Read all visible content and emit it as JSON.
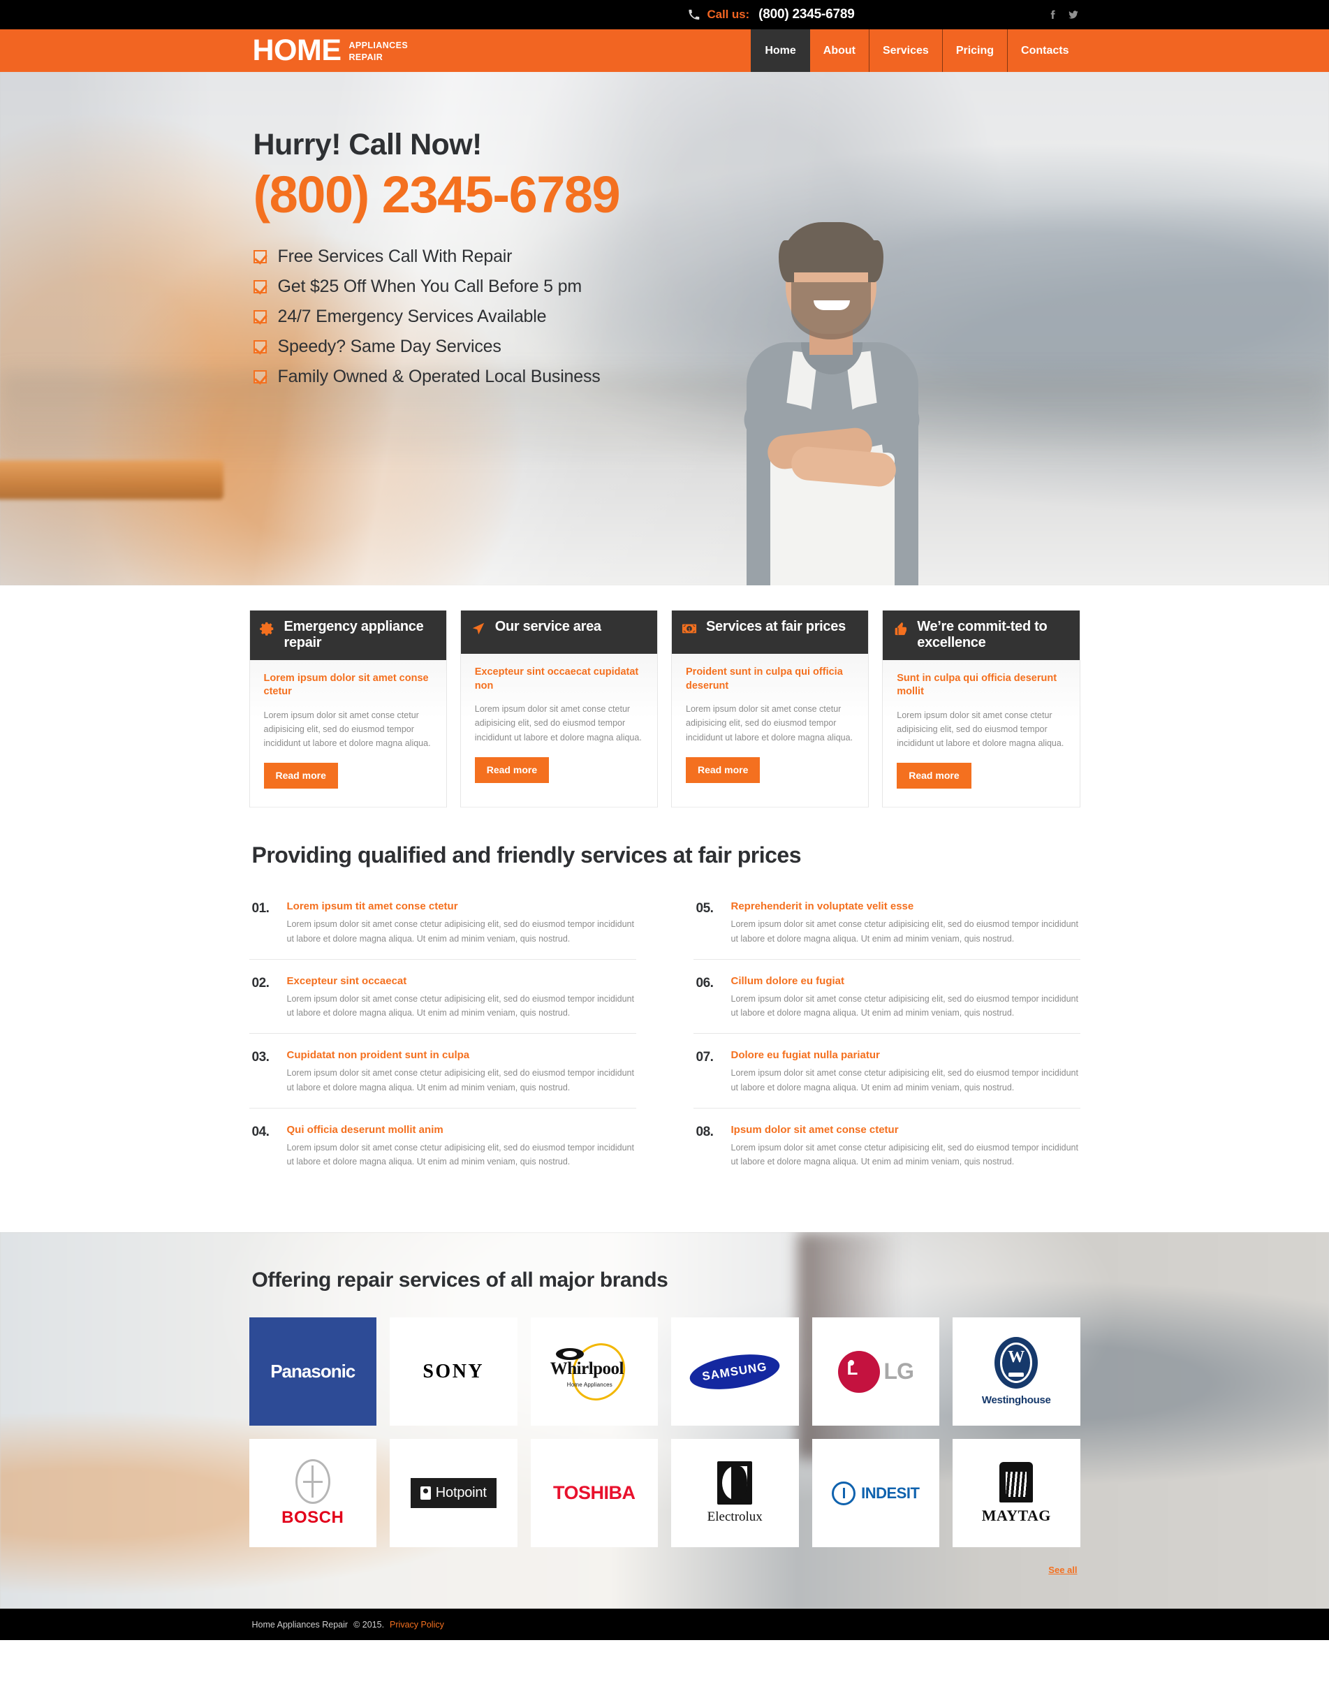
{
  "topbar": {
    "phone_icon": "phone-icon",
    "call_label": "Call us:",
    "phone_number": "(800) 2345-6789",
    "socials": [
      {
        "name": "facebook-icon",
        "glyph": "f"
      },
      {
        "name": "twitter-icon",
        "glyph": "t"
      }
    ]
  },
  "header": {
    "logo_main": "HOME",
    "logo_line1": "APPLIANCES",
    "logo_line2": "REPAIR",
    "nav": [
      {
        "label": "Home",
        "active": true
      },
      {
        "label": "About",
        "active": false
      },
      {
        "label": "Services",
        "active": false
      },
      {
        "label": "Pricing",
        "active": false
      },
      {
        "label": "Contacts",
        "active": false
      }
    ]
  },
  "hero": {
    "title": "Hurry! Call Now!",
    "phone": "(800) 2345-6789",
    "bullets": [
      "Free Services Call With Repair",
      "Get $25 Off When You Call Before 5 pm",
      "24/7 Emergency Services Available",
      "Speedy? Same Day Services",
      "Family Owned & Operated Local Business"
    ]
  },
  "cards": [
    {
      "icon": "gear-icon",
      "title": "Emergency appliance repair",
      "subtitle": "Lorem ipsum dolor sit amet conse ctetur",
      "text": "Lorem ipsum dolor sit amet conse ctetur adipisicing elit, sed do eiusmod tempor incididunt ut labore et dolore magna aliqua.",
      "button": "Read more"
    },
    {
      "icon": "navigation-arrow-icon",
      "title": "Our service area",
      "subtitle": "Excepteur sint occaecat cupidatat non",
      "text": "Lorem ipsum dolor sit amet conse ctetur adipisicing elit, sed do eiusmod tempor incididunt ut labore et dolore magna aliqua.",
      "button": "Read more"
    },
    {
      "icon": "banknote-icon",
      "title": "Services at fair prices",
      "subtitle": "Proident sunt in culpa qui officia deserunt",
      "text": "Lorem ipsum dolor sit amet conse ctetur adipisicing elit, sed do eiusmod tempor incididunt ut labore et dolore magna aliqua.",
      "button": "Read more"
    },
    {
      "icon": "thumbs-up-icon",
      "title": "We’re commit-ted to excellence",
      "subtitle": "Sunt in culpa qui officia deserunt mollit",
      "text": "Lorem ipsum dolor sit amet conse ctetur adipisicing elit, sed do eiusmod tempor incididunt ut labore et dolore magna aliqua.",
      "button": "Read more"
    }
  ],
  "services": {
    "heading": "Providing qualified and friendly services at fair prices",
    "body": "Lorem ipsum dolor sit amet conse ctetur adipisicing elit, sed do eiusmod tempor incididunt ut labore et dolore magna aliqua. Ut enim ad minim veniam, quis nostrud.",
    "items": [
      {
        "num": "01.",
        "title": "Lorem ipsum tit amet conse ctetur"
      },
      {
        "num": "02.",
        "title": "Excepteur sint occaecat"
      },
      {
        "num": "03.",
        "title": "Cupidatat non proident sunt in culpa"
      },
      {
        "num": "04.",
        "title": "Qui officia deserunt mollit anim"
      },
      {
        "num": "05.",
        "title": "Reprehenderit in voluptate velit esse"
      },
      {
        "num": "06.",
        "title": "Cillum dolore eu fugiat"
      },
      {
        "num": "07.",
        "title": "Dolore eu fugiat nulla pariatur"
      },
      {
        "num": "08.",
        "title": "Ipsum dolor sit amet conse ctetur"
      }
    ]
  },
  "brands": {
    "heading": "Offering repair services of all major brands",
    "see_all": "See all",
    "items": [
      {
        "name": "Panasonic"
      },
      {
        "name": "SONY"
      },
      {
        "name": "Whirlpool",
        "tagline": "Home  Appliances"
      },
      {
        "name": "SAMSUNG"
      },
      {
        "name": "LG"
      },
      {
        "name": "Westinghouse"
      },
      {
        "name": "BOSCH"
      },
      {
        "name": "Hotpoint"
      },
      {
        "name": "TOSHIBA"
      },
      {
        "name": "Electrolux"
      },
      {
        "name": "INDESIT"
      },
      {
        "name": "MAYTAG"
      }
    ]
  },
  "footer": {
    "site_name": "Home Appliances Repair",
    "copyright": "© 2015.",
    "privacy": "Privacy Policy"
  },
  "colors": {
    "accent": "#f4701f",
    "dark": "#333333",
    "black": "#000000",
    "text": "#2e3033",
    "muted": "#8c8c8c"
  }
}
